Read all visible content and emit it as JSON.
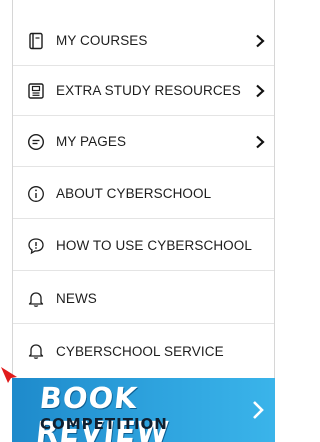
{
  "menu": {
    "items": [
      {
        "label": "MY COURSES",
        "icon": "book-icon",
        "has_chevron": true
      },
      {
        "label": "EXTRA STUDY RESOURCES",
        "icon": "notebook-icon",
        "has_chevron": true
      },
      {
        "label": "MY PAGES",
        "icon": "page-icon",
        "has_chevron": true
      },
      {
        "label": "ABOUT CYBERSCHOOL",
        "icon": "info-icon",
        "has_chevron": false
      },
      {
        "label": "HOW TO USE CYBERSCHOOL",
        "icon": "help-chat-icon",
        "has_chevron": false
      },
      {
        "label": "NEWS",
        "icon": "bell-icon",
        "has_chevron": false
      },
      {
        "label": "CYBERSCHOOL SERVICE",
        "icon": "bell-icon",
        "has_chevron": false
      }
    ]
  },
  "banner": {
    "title": "BOOK REVIEW",
    "subtitle": "COMPETITION"
  },
  "colors": {
    "banner": "#2ea3de",
    "arrow": "#e01b1b",
    "text": "#1d1d1d"
  }
}
